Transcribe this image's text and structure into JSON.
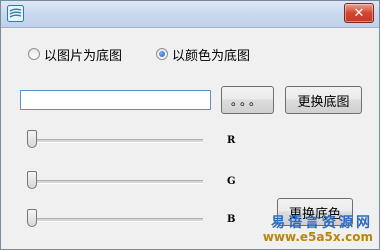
{
  "window": {
    "title": "",
    "close_label": "✕"
  },
  "background_mode": {
    "options": [
      {
        "label": "以图片为底图",
        "checked": false
      },
      {
        "label": "以颜色为底图",
        "checked": true
      }
    ]
  },
  "image_path_input": {
    "value": "",
    "placeholder": ""
  },
  "buttons": {
    "browse_label": "。。。",
    "change_image_label": "更换底图",
    "change_color_label": "更换底色"
  },
  "sliders": [
    {
      "label": "R",
      "value": 0
    },
    {
      "label": "G",
      "value": 0
    },
    {
      "label": "B",
      "value": 0
    }
  ],
  "watermark": {
    "text": "易语言资源网",
    "url": "www.e5a5x.com"
  },
  "colors": {
    "accent": "#1b5fb8",
    "close_button": "#d2462f"
  }
}
